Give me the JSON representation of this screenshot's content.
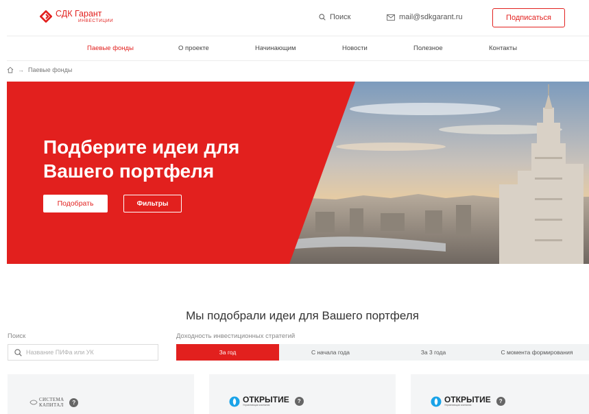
{
  "header": {
    "logo": {
      "title": "СДК Гарант",
      "subtitle": "ИНВЕСТИЦИИ",
      "icon": "sdk-logo-icon",
      "color": "#e2201e"
    },
    "search_label": "Поиск",
    "email": "mail@sdkgarant.ru",
    "subscribe_label": "Подписаться"
  },
  "nav": {
    "items": [
      {
        "label": "Паевые фонды",
        "active": true
      },
      {
        "label": "О проекте",
        "active": false
      },
      {
        "label": "Начинающим",
        "active": false
      },
      {
        "label": "Новости",
        "active": false
      },
      {
        "label": "Полезное",
        "active": false
      },
      {
        "label": "Контакты",
        "active": false
      }
    ]
  },
  "breadcrumb": {
    "home_icon": "home-icon",
    "current": "Паевые фонды"
  },
  "hero": {
    "title": "Подберите идеи для Вашего портфеля",
    "primary_button": "Подобрать",
    "secondary_button": "Фильтры"
  },
  "section": {
    "title": "Мы подобрали идеи для Вашего портфеля",
    "search_label": "Поиск",
    "search_placeholder": "Название ПИФа или УК",
    "yield_label": "Доходность инвестиционных стратегий",
    "tabs": [
      {
        "label": "За год",
        "active": true
      },
      {
        "label": "С начала года",
        "active": false
      },
      {
        "label": "За 3 года",
        "active": false
      },
      {
        "label": "С момента формирования",
        "active": false
      }
    ]
  },
  "cards": [
    {
      "logo_lines": [
        "СИСТЕМА",
        "КАПИТАЛ"
      ],
      "help": "?"
    },
    {
      "logo_name": "ОТКРЫТИЕ",
      "logo_sub": "Управляющая компания",
      "help": "?"
    },
    {
      "logo_name": "ОТКРЫТИЕ",
      "logo_sub": "Управляющая компания",
      "help": "?"
    }
  ],
  "colors": {
    "accent": "#e2201e",
    "tab_bg": "#f1f3f4",
    "card_bg": "#f4f5f6"
  }
}
